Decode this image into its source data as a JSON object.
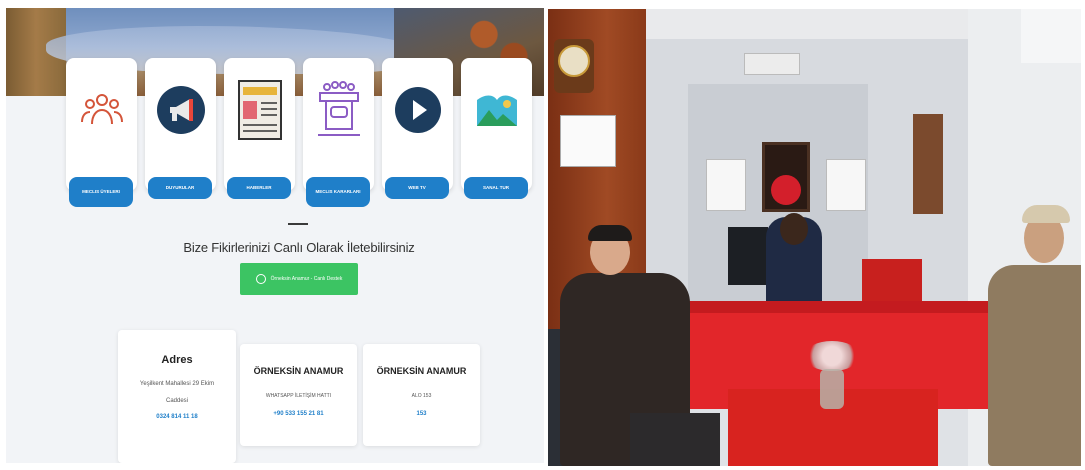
{
  "website": {
    "services": [
      {
        "label": "Meclis Üyeleri",
        "icon": "people-icon"
      },
      {
        "label": "Duyurular",
        "icon": "megaphone-icon"
      },
      {
        "label": "Haberler",
        "icon": "newspaper-icon"
      },
      {
        "label": "Meclis Kararları",
        "icon": "podium-icon"
      },
      {
        "label": "Web TV",
        "icon": "play-icon"
      },
      {
        "label": "Sanal Tur",
        "icon": "landscape-icon"
      }
    ],
    "tagline": "Bize Fikirlerinizi Canlı Olarak İletebilirsiniz",
    "whatsapp_button": "Örneksin Anamur - Canlı Destek",
    "contact": {
      "address": {
        "title": "Adres",
        "line1": "Yeşilkent Mahallesi 29 Ekim",
        "line2": "Caddesi",
        "phone": "0324 814 11 18"
      },
      "whatsapp": {
        "title": "ÖRNEKSİN ANAMUR",
        "subtitle": "WHATSAPP İLETİŞİM HATTI",
        "phone": "+90 533 155 21 81"
      },
      "alo": {
        "title": "ÖRNEKSİN ANAMUR",
        "subtitle": "ALO 153",
        "number": "153"
      }
    }
  },
  "colors": {
    "accent_blue": "#1f7fc9",
    "whatsapp_green": "#3cc463",
    "desk_red": "#e2262a"
  }
}
